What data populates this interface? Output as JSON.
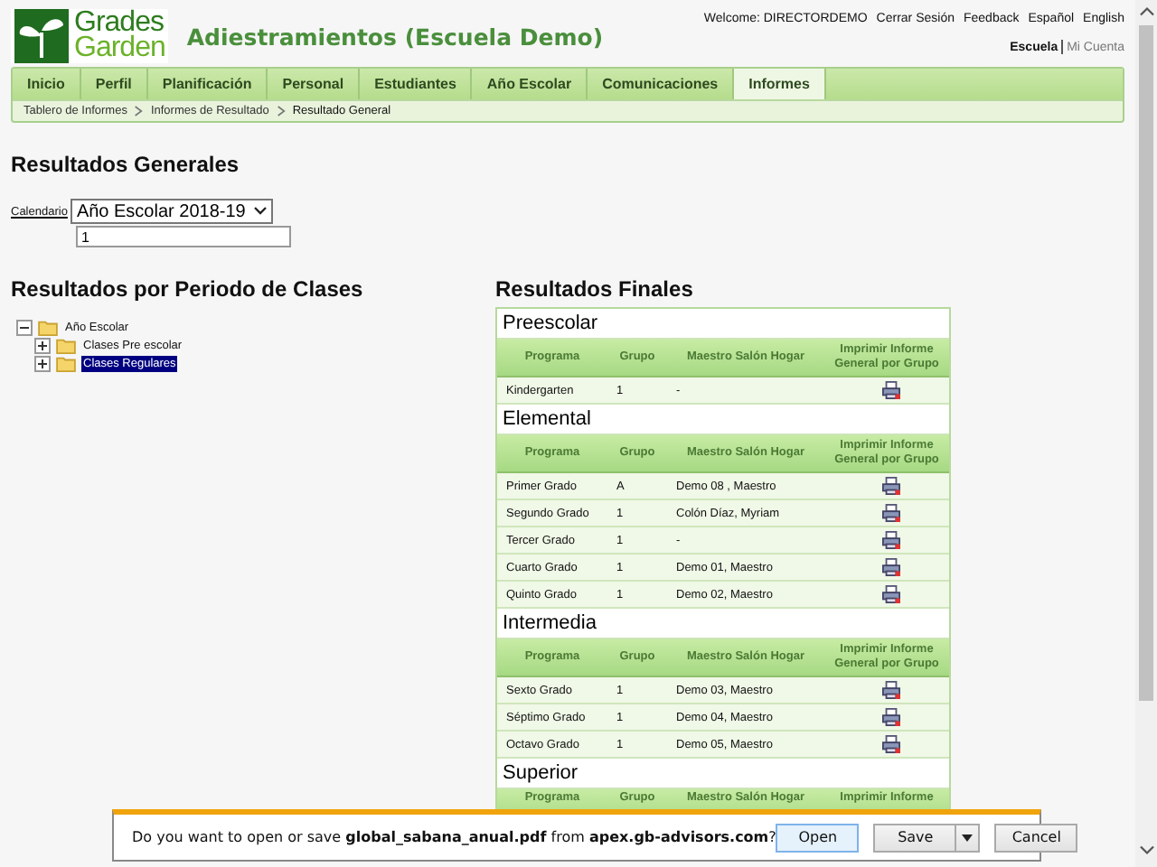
{
  "header": {
    "logo": {
      "line1": "Grades",
      "line2": "Garden"
    },
    "site_title": "Adiestramientos (Escuela Demo)",
    "top_links": [
      "Welcome: DIRECTORDEMO",
      "Cerrar Sesión",
      "Feedback",
      "Español",
      "English"
    ],
    "account_links": [
      {
        "label": "Escuela",
        "selected": true
      },
      {
        "label": "Mi Cuenta",
        "selected": false
      }
    ]
  },
  "nav": {
    "tabs": [
      {
        "label": "Inicio",
        "selected": false
      },
      {
        "label": "Perfil",
        "selected": false
      },
      {
        "label": "Planificación",
        "selected": false
      },
      {
        "label": "Personal",
        "selected": false
      },
      {
        "label": "Estudiantes",
        "selected": false
      },
      {
        "label": "Año Escolar",
        "selected": false
      },
      {
        "label": "Comunicaciones",
        "selected": false
      },
      {
        "label": "Informes",
        "selected": true
      }
    ],
    "breadcrumb": [
      "Tablero de Informes",
      "Informes de Resultado",
      "Resultado General"
    ]
  },
  "general": {
    "title": "Resultados Generales",
    "calendar_label": "Calendario",
    "calendar_value": "Año Escolar 2018-19",
    "input_value": "1"
  },
  "periods": {
    "title": "Resultados por Periodo de Clases",
    "tree": [
      {
        "label": "Año Escolar",
        "expanded": true,
        "selected": false,
        "children": [
          {
            "label": "Clases Pre escolar",
            "expanded": false,
            "selected": false
          },
          {
            "label": "Clases Regulares",
            "expanded": false,
            "selected": true
          }
        ]
      }
    ]
  },
  "final": {
    "title": "Resultados Finales",
    "sections": [
      {
        "name": "Preescolar",
        "columns": [
          "Programa",
          "Grupo",
          "Maestro Salón Hogar",
          "Imprimir Informe General por Grupo"
        ],
        "rows": [
          {
            "programa": "Kindergarten",
            "grupo": "1",
            "maestro": "-"
          }
        ]
      },
      {
        "name": "Elemental",
        "columns": [
          "Programa",
          "Grupo",
          "Maestro Salón Hogar",
          "Imprimir Informe General por Grupo"
        ],
        "rows": [
          {
            "programa": "Primer Grado",
            "grupo": "A",
            "maestro": "Demo 08 , Maestro"
          },
          {
            "programa": "Segundo Grado",
            "grupo": "1",
            "maestro": "Colón Díaz, Myriam"
          },
          {
            "programa": "Tercer Grado",
            "grupo": "1",
            "maestro": "-"
          },
          {
            "programa": "Cuarto Grado",
            "grupo": "1",
            "maestro": "Demo 01, Maestro"
          },
          {
            "programa": "Quinto Grado",
            "grupo": "1",
            "maestro": "Demo 02, Maestro"
          }
        ]
      },
      {
        "name": "Intermedia",
        "columns": [
          "Programa",
          "Grupo",
          "Maestro Salón Hogar",
          "Imprimir Informe General por Grupo"
        ],
        "rows": [
          {
            "programa": "Sexto Grado",
            "grupo": "1",
            "maestro": "Demo 03, Maestro"
          },
          {
            "programa": "Séptimo Grado",
            "grupo": "1",
            "maestro": "Demo 04, Maestro"
          },
          {
            "programa": "Octavo Grado",
            "grupo": "1",
            "maestro": "Demo 05, Maestro"
          }
        ]
      },
      {
        "name": "Superior",
        "columns": [
          "Programa",
          "Grupo",
          "Maestro Salón Hogar",
          "Imprimir Informe"
        ]
      }
    ]
  },
  "download_bar": {
    "message": "Do you want to open or save **global_sabana_anual.pdf** from **apex.gb-advisors.com**?",
    "buttons": [
      {
        "label": "Open",
        "kind": "primary"
      },
      {
        "label": "Save",
        "kind": "split"
      },
      {
        "label": "Cancel",
        "kind": "plain"
      }
    ]
  }
}
